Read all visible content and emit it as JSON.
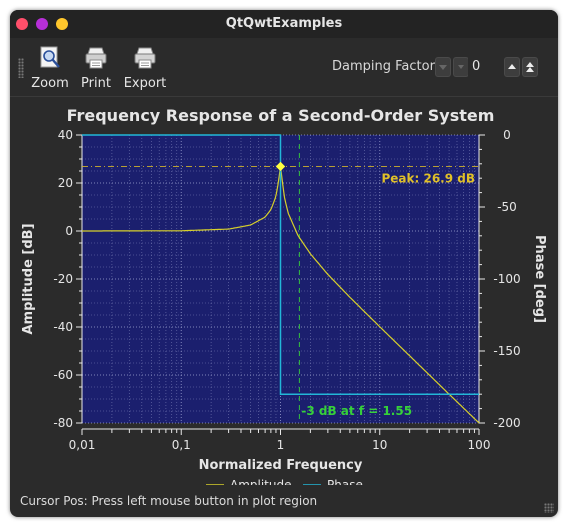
{
  "window": {
    "title": "QtQwtExamples"
  },
  "toolbar": {
    "zoom_label": "Zoom",
    "print_label": "Print",
    "export_label": "Export",
    "damping_label": "Damping Factor",
    "damping_value": "0"
  },
  "status": {
    "text": "Cursor Pos: Press left mouse button in plot region"
  },
  "colors": {
    "plot_bg": "#1b1f6e",
    "amplitude": "#d7d02b",
    "phase": "#22b7d8",
    "peak_marker": "#e0c028",
    "cutoff_marker": "#36d13a"
  },
  "chart_data": {
    "type": "line",
    "title": "Frequency Response of a Second-Order System",
    "xlabel": "Normalized Frequency",
    "ylabel": "Amplitude [dB]",
    "y2label": "Phase [deg]",
    "xscale": "log",
    "xlim": [
      0.01,
      100
    ],
    "ylim": [
      -80,
      40
    ],
    "y2lim": [
      -200,
      0
    ],
    "xticks": [
      "0,01",
      "0,1",
      "1",
      "10",
      "100"
    ],
    "xtick_values": [
      0.01,
      0.1,
      1,
      10,
      100
    ],
    "yticks": [
      40,
      20,
      0,
      -20,
      -40,
      -60,
      -80
    ],
    "y2ticks": [
      0,
      -50,
      -100,
      -150,
      -200
    ],
    "grid": true,
    "legend": {
      "placement": "bottom",
      "entries": [
        "Amplitude",
        "Phase"
      ]
    },
    "series": [
      {
        "name": "Amplitude",
        "axis": "left",
        "x": [
          0.01,
          0.1,
          0.3,
          0.5,
          0.7,
          0.8,
          0.9,
          0.95,
          1.0,
          1.05,
          1.1,
          1.2,
          1.5,
          2,
          3,
          5,
          10,
          20,
          50,
          100
        ],
        "y": [
          0,
          0.1,
          0.8,
          2.5,
          5.8,
          8.9,
          14.4,
          20.2,
          26.9,
          20.0,
          13.5,
          7.3,
          -1.9,
          -9.5,
          -18.1,
          -27.6,
          -39.9,
          -52.0,
          -68.0,
          -80.0
        ]
      },
      {
        "name": "Phase",
        "axis": "right",
        "x": [
          0.01,
          0.999,
          1.001,
          100
        ],
        "y": [
          0,
          0,
          -180,
          -180
        ]
      }
    ],
    "annotations": [
      {
        "text": "Peak: 26.9 dB",
        "x": 1,
        "y": 26.9
      },
      {
        "text": "-3 dB at f = 1.55",
        "x": 1.55
      }
    ]
  }
}
